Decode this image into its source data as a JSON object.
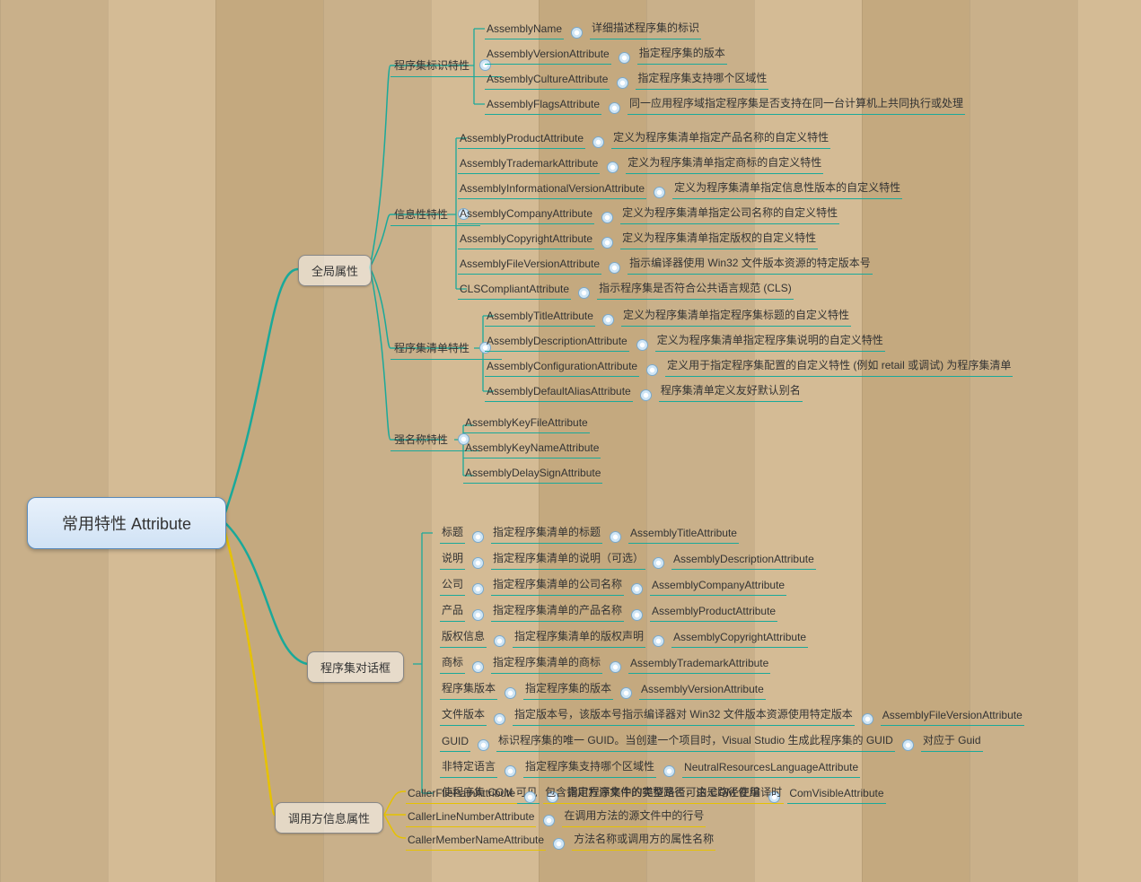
{
  "root": "常用特性 Attribute",
  "branches": {
    "global": {
      "label": "全局属性",
      "groups": {
        "identity": {
          "label": "程序集标识特性",
          "items": [
            {
              "a": "AssemblyName",
              "d": "详细描述程序集的标识"
            },
            {
              "a": "AssemblyVersionAttribute",
              "d": "指定程序集的版本"
            },
            {
              "a": "AssemblyCultureAttribute",
              "d": "指定程序集支持哪个区域性"
            },
            {
              "a": "AssemblyFlagsAttribute",
              "d": "同一应用程序域指定程序集是否支持在同一台计算机上共同执行或处理"
            }
          ]
        },
        "info": {
          "label": "信息性特性",
          "items": [
            {
              "a": "AssemblyProductAttribute",
              "d": "定义为程序集清单指定产品名称的自定义特性"
            },
            {
              "a": "AssemblyTrademarkAttribute",
              "d": "定义为程序集清单指定商标的自定义特性"
            },
            {
              "a": "AssemblyInformationalVersionAttribute",
              "d": "定义为程序集清单指定信息性版本的自定义特性"
            },
            {
              "a": "AssemblyCompanyAttribute",
              "d": "定义为程序集清单指定公司名称的自定义特性"
            },
            {
              "a": "AssemblyCopyrightAttribute",
              "d": "定义为程序集清单指定版权的自定义特性"
            },
            {
              "a": "AssemblyFileVersionAttribute",
              "d": "指示编译器使用 Win32 文件版本资源的特定版本号"
            },
            {
              "a": "CLSCompliantAttribute",
              "d": "指示程序集是否符合公共语言规范 (CLS)"
            }
          ]
        },
        "manifest": {
          "label": "程序集清单特性",
          "items": [
            {
              "a": "AssemblyTitleAttribute",
              "d": "定义为程序集清单指定程序集标题的自定义特性"
            },
            {
              "a": "AssemblyDescriptionAttribute",
              "d": "定义为程序集清单指定程序集说明的自定义特性"
            },
            {
              "a": "AssemblyConfigurationAttribute",
              "d": "定义用于指定程序集配置的自定义特性 (例如 retail 或调试) 为程序集清单"
            },
            {
              "a": "AssemblyDefaultAliasAttribute",
              "d": "程序集清单定义友好默认别名"
            }
          ]
        },
        "strong": {
          "label": "强名称特性",
          "items": [
            {
              "a": "AssemblyKeyFileAttribute"
            },
            {
              "a": "AssemblyKeyNameAttribute"
            },
            {
              "a": "AssemblyDelaySignAttribute"
            }
          ]
        }
      }
    },
    "dialog": {
      "label": "程序集对话框",
      "items": [
        {
          "k": "标题",
          "d": "指定程序集清单的标题",
          "a": "AssemblyTitleAttribute"
        },
        {
          "k": "说明",
          "d": "指定程序集清单的说明（可选）",
          "a": "AssemblyDescriptionAttribute"
        },
        {
          "k": "公司",
          "d": "指定程序集清单的公司名称",
          "a": "AssemblyCompanyAttribute"
        },
        {
          "k": "产品",
          "d": "指定程序集清单的产品名称",
          "a": "AssemblyProductAttribute"
        },
        {
          "k": "版权信息",
          "d": "指定程序集清单的版权声明",
          "a": "AssemblyCopyrightAttribute"
        },
        {
          "k": "商标",
          "d": "指定程序集清单的商标",
          "a": "AssemblyTrademarkAttribute"
        },
        {
          "k": "程序集版本",
          "d": "指定程序集的版本",
          "a": "AssemblyVersionAttribute"
        },
        {
          "k": "文件版本",
          "d": "指定版本号，该版本号指示编译器对 Win32 文件版本资源使用特定版本",
          "a": "AssemblyFileVersionAttribute"
        },
        {
          "k": "GUID",
          "d": "标识程序集的唯一 GUID。当创建一个项目时，Visual Studio 生成此程序集的 GUID",
          "a": "对应于 Guid"
        },
        {
          "k": "非特定语言",
          "d": "指定程序集支持哪个区域性",
          "a": "NeutralResourcesLanguageAttribute"
        },
        {
          "k": "使程序集 COM 可见",
          "d": "指定程序集中的类型是否可由 COM 使用",
          "a": "ComVisibleAttribute"
        }
      ]
    },
    "caller": {
      "label": "调用方信息属性",
      "items": [
        {
          "a": "CallerFilePathAttribute",
          "d": "包含调用方源文件的完整路径，这是路径在编译时"
        },
        {
          "a": "CallerLineNumberAttribute",
          "d": "在调用方法的源文件中的行号"
        },
        {
          "a": "CallerMemberNameAttribute",
          "d": "方法名称或调用方的属性名称"
        }
      ]
    }
  }
}
